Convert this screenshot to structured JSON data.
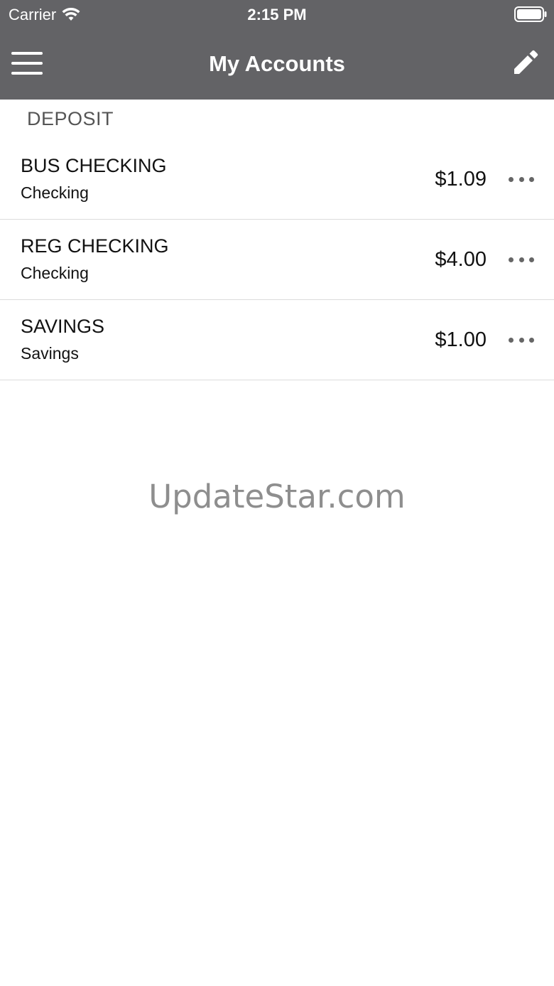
{
  "status_bar": {
    "carrier": "Carrier",
    "time": "2:15 PM",
    "wifi_icon": "wifi-icon",
    "battery_icon": "battery-icon"
  },
  "navbar": {
    "title": "My Accounts",
    "menu_icon": "hamburger-menu-icon",
    "edit_icon": "pencil-icon",
    "background_color": "#636366"
  },
  "section": {
    "header": "DEPOSIT"
  },
  "accounts": [
    {
      "name": "BUS CHECKING",
      "type": "Checking",
      "balance": "$1.09"
    },
    {
      "name": "REG CHECKING",
      "type": "Checking",
      "balance": "$4.00"
    },
    {
      "name": "SAVINGS",
      "type": "Savings",
      "balance": "$1.00"
    }
  ],
  "watermark": "UpdateStar.com"
}
